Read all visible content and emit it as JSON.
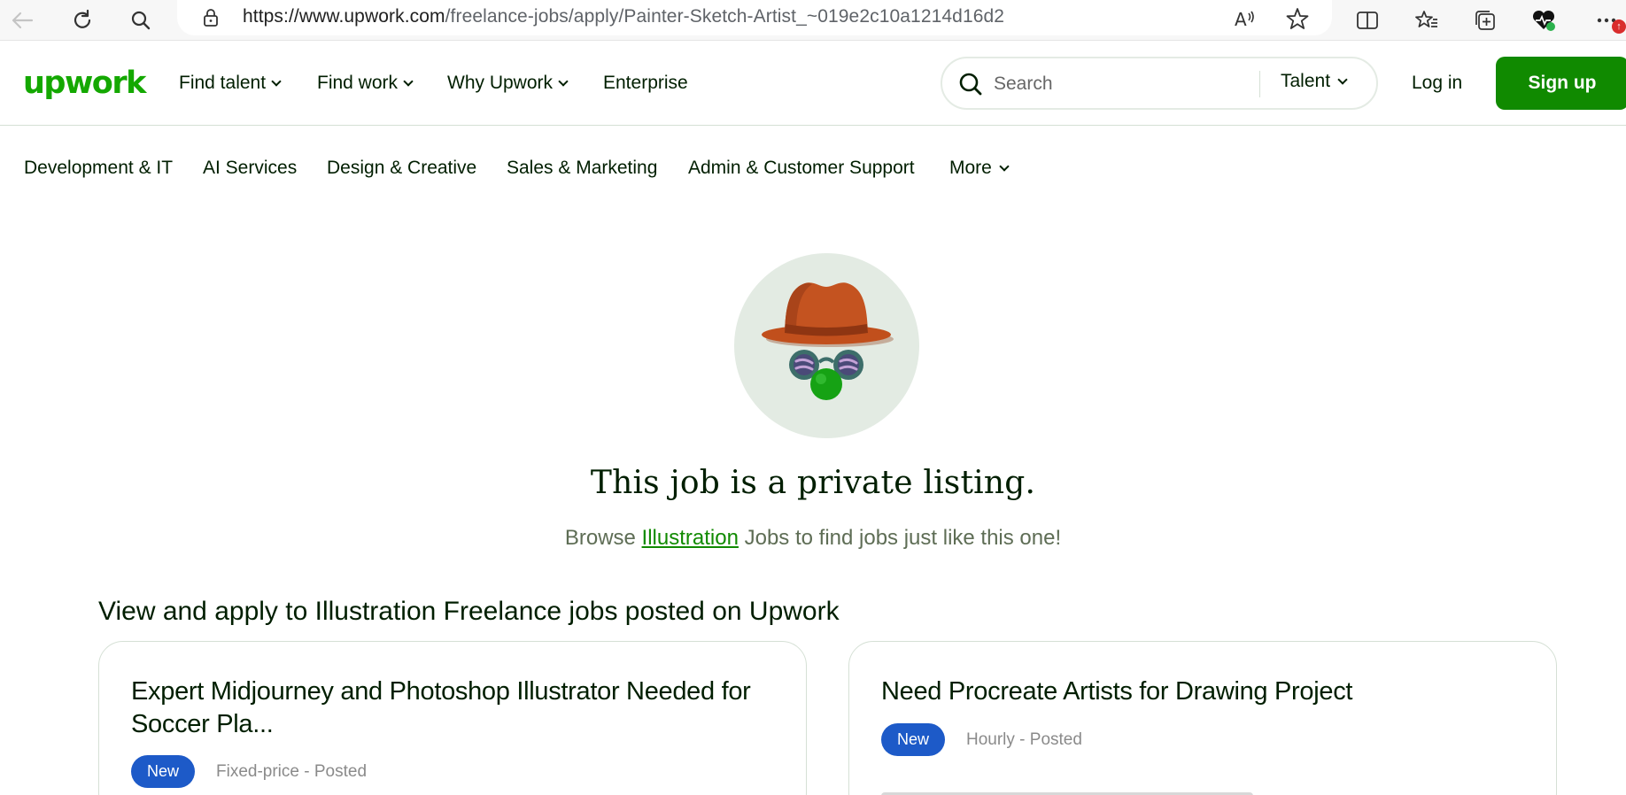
{
  "browser": {
    "url_host": "https://www.upwork.com",
    "url_path": "/freelance-jobs/apply/Painter-Sketch-Artist_~019e2c10a1214d16d2",
    "icons": [
      "back-icon",
      "refresh-icon",
      "search-icon",
      "lock-icon",
      "read-aloud-icon",
      "favorite-star-icon",
      "split-screen-icon",
      "favorites-icon",
      "collections-icon",
      "browser-essentials-icon",
      "more-icon"
    ]
  },
  "header": {
    "logo": "upwork",
    "nav": [
      "Find talent",
      "Find work",
      "Why Upwork",
      "Enterprise"
    ],
    "search_placeholder": "Search",
    "search_category": "Talent",
    "login": "Log in",
    "signup": "Sign up"
  },
  "categories": [
    "Development & IT",
    "AI Services",
    "Design & Creative",
    "Sales & Marketing",
    "Admin & Customer Support",
    "More"
  ],
  "hero": {
    "title": "This job is a private listing.",
    "browse_pre": "Browse",
    "browse_link": "Illustration",
    "browse_post": "Jobs to find jobs just like this one!"
  },
  "section_title": "View and apply to Illustration Freelance jobs posted on Upwork",
  "jobs": [
    {
      "title": "Expert Midjourney and Photoshop Illustrator Needed for Soccer Pla...",
      "badge": "New",
      "meta": "Fixed-price - Posted"
    },
    {
      "title": "Need Procreate Artists for Drawing Project",
      "badge": "New",
      "meta": "Hourly - Posted"
    }
  ],
  "colors": {
    "brand_green": "#14a800",
    "signup_green": "#108a00",
    "badge_blue": "#1d5ac8",
    "hat_orange": "#c14f1c"
  }
}
